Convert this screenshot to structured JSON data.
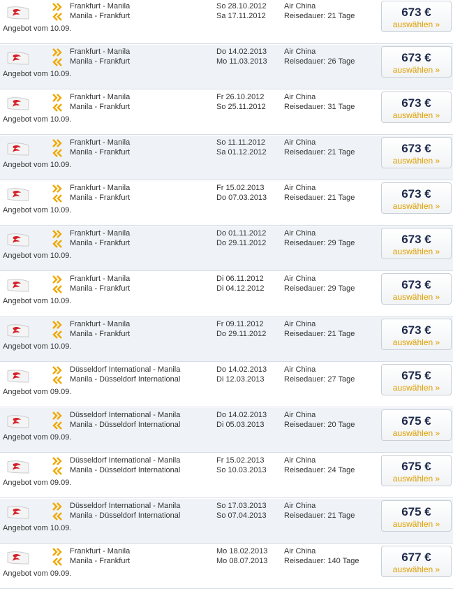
{
  "colors": {
    "row_alt_background": "#eff3f7",
    "price_text": "#1e2a4a",
    "select_text": "#e0a000",
    "arrow_outbound": "#f0a800",
    "arrow_return": "#f0a800"
  },
  "icons": {
    "airline_logo": "air-china-phoenix-icon",
    "outbound": "double-chevron-right-icon",
    "return": "double-chevron-left-icon"
  },
  "offers": [
    {
      "outbound_route": "Frankfurt - Manila",
      "return_route": "Manila - Frankfurt",
      "outbound_date": "So 28.10.2012",
      "return_date": "Sa 17.11.2012",
      "airline": "Air China",
      "duration": "Reisedauer: 21 Tage",
      "price": "673 €",
      "select_label": "auswählen »",
      "offer_date": "Angebot vom 10.09."
    },
    {
      "outbound_route": "Frankfurt - Manila",
      "return_route": "Manila - Frankfurt",
      "outbound_date": "Do 14.02.2013",
      "return_date": "Mo 11.03.2013",
      "airline": "Air China",
      "duration": "Reisedauer: 26 Tage",
      "price": "673 €",
      "select_label": "auswählen »",
      "offer_date": "Angebot vom 10.09."
    },
    {
      "outbound_route": "Frankfurt - Manila",
      "return_route": "Manila - Frankfurt",
      "outbound_date": "Fr 26.10.2012",
      "return_date": "So 25.11.2012",
      "airline": "Air China",
      "duration": "Reisedauer: 31 Tage",
      "price": "673 €",
      "select_label": "auswählen »",
      "offer_date": "Angebot vom 10.09."
    },
    {
      "outbound_route": "Frankfurt - Manila",
      "return_route": "Manila - Frankfurt",
      "outbound_date": "So 11.11.2012",
      "return_date": "Sa 01.12.2012",
      "airline": "Air China",
      "duration": "Reisedauer: 21 Tage",
      "price": "673 €",
      "select_label": "auswählen »",
      "offer_date": "Angebot vom 10.09."
    },
    {
      "outbound_route": "Frankfurt - Manila",
      "return_route": "Manila - Frankfurt",
      "outbound_date": "Fr 15.02.2013",
      "return_date": "Do 07.03.2013",
      "airline": "Air China",
      "duration": "Reisedauer: 21 Tage",
      "price": "673 €",
      "select_label": "auswählen »",
      "offer_date": "Angebot vom 10.09."
    },
    {
      "outbound_route": "Frankfurt - Manila",
      "return_route": "Manila - Frankfurt",
      "outbound_date": "Do 01.11.2012",
      "return_date": "Do 29.11.2012",
      "airline": "Air China",
      "duration": "Reisedauer: 29 Tage",
      "price": "673 €",
      "select_label": "auswählen »",
      "offer_date": "Angebot vom 10.09."
    },
    {
      "outbound_route": "Frankfurt - Manila",
      "return_route": "Manila - Frankfurt",
      "outbound_date": "Di 06.11.2012",
      "return_date": "Di 04.12.2012",
      "airline": "Air China",
      "duration": "Reisedauer: 29 Tage",
      "price": "673 €",
      "select_label": "auswählen »",
      "offer_date": "Angebot vom 10.09."
    },
    {
      "outbound_route": "Frankfurt - Manila",
      "return_route": "Manila - Frankfurt",
      "outbound_date": "Fr 09.11.2012",
      "return_date": "Do 29.11.2012",
      "airline": "Air China",
      "duration": "Reisedauer: 21 Tage",
      "price": "673 €",
      "select_label": "auswählen »",
      "offer_date": "Angebot vom 10.09."
    },
    {
      "outbound_route": "Düsseldorf International - Manila",
      "return_route": "Manila - Düsseldorf International",
      "outbound_date": "Do 14.02.2013",
      "return_date": "Di 12.03.2013",
      "airline": "Air China",
      "duration": "Reisedauer: 27 Tage",
      "price": "675 €",
      "select_label": "auswählen »",
      "offer_date": "Angebot vom 09.09."
    },
    {
      "outbound_route": "Düsseldorf International - Manila",
      "return_route": "Manila - Düsseldorf International",
      "outbound_date": "Do 14.02.2013",
      "return_date": "Di 05.03.2013",
      "airline": "Air China",
      "duration": "Reisedauer: 20 Tage",
      "price": "675 €",
      "select_label": "auswählen »",
      "offer_date": "Angebot vom 09.09."
    },
    {
      "outbound_route": "Düsseldorf International - Manila",
      "return_route": "Manila - Düsseldorf International",
      "outbound_date": "Fr 15.02.2013",
      "return_date": "So 10.03.2013",
      "airline": "Air China",
      "duration": "Reisedauer: 24 Tage",
      "price": "675 €",
      "select_label": "auswählen »",
      "offer_date": "Angebot vom 09.09."
    },
    {
      "outbound_route": "Düsseldorf International - Manila",
      "return_route": "Manila - Düsseldorf International",
      "outbound_date": "So 17.03.2013",
      "return_date": "So 07.04.2013",
      "airline": "Air China",
      "duration": "Reisedauer: 21 Tage",
      "price": "675 €",
      "select_label": "auswählen »",
      "offer_date": "Angebot vom 10.09."
    },
    {
      "outbound_route": "Frankfurt - Manila",
      "return_route": "Manila - Frankfurt",
      "outbound_date": "Mo 18.02.2013",
      "return_date": "Mo 08.07.2013",
      "airline": "Air China",
      "duration": "Reisedauer: 140 Tage",
      "price": "677 €",
      "select_label": "auswählen »",
      "offer_date": "Angebot vom 09.09."
    }
  ]
}
